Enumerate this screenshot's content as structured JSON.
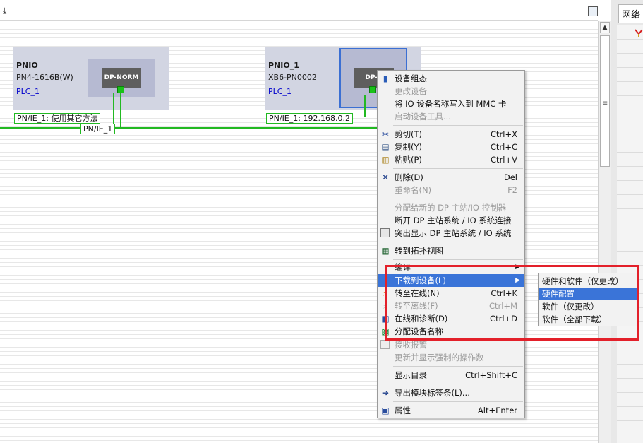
{
  "toolbar": {
    "download_icon": "download-icon",
    "panel_icon": "panel-toggle-icon"
  },
  "right_panel": {
    "tab_label": "网络"
  },
  "devices": [
    {
      "name": "PNIO",
      "model": "PN4-1616B(W)",
      "plc_link": "PLC_1",
      "chip_label": "DP-NORM",
      "net_label": "PN/IE_1:  使用其它方法"
    },
    {
      "name": "PNIO_1",
      "model": "XB6-PN0002",
      "plc_link": "PLC_1",
      "chip_label": "DP-N",
      "net_label": "PN/IE_1:  192.168.0.2"
    }
  ],
  "network_label": "PN/IE_1",
  "context_menu": {
    "items": [
      {
        "label": "设备组态",
        "shortcut": "",
        "icon": "device-config-icon",
        "disabled": false
      },
      {
        "label": "更改设备",
        "shortcut": "",
        "icon": "",
        "disabled": true
      },
      {
        "label": "将 IO 设备名称写入到 MMC 卡",
        "shortcut": "",
        "icon": "",
        "disabled": false
      },
      {
        "label": "启动设备工具...",
        "shortcut": "",
        "icon": "",
        "disabled": true
      },
      {
        "label": "剪切(T)",
        "shortcut": "Ctrl+X",
        "icon": "scissors-icon",
        "disabled": false
      },
      {
        "label": "复制(Y)",
        "shortcut": "Ctrl+C",
        "icon": "copy-icon",
        "disabled": false
      },
      {
        "label": "粘贴(P)",
        "shortcut": "Ctrl+V",
        "icon": "paste-icon",
        "disabled": false
      },
      {
        "label": "删除(D)",
        "shortcut": "Del",
        "icon": "delete-x-icon",
        "disabled": false
      },
      {
        "label": "重命名(N)",
        "shortcut": "F2",
        "icon": "",
        "disabled": true
      },
      {
        "label": "分配给新的 DP 主站/IO 控制器",
        "shortcut": "",
        "icon": "",
        "disabled": true
      },
      {
        "label": "断开 DP 主站系统 / IO 系统连接",
        "shortcut": "",
        "icon": "",
        "disabled": false
      },
      {
        "label": "突出显示 DP 主站系统 / IO 系统",
        "shortcut": "",
        "icon": "highlight-icon",
        "disabled": false
      },
      {
        "label": "转到拓扑视图",
        "shortcut": "",
        "icon": "topology-icon",
        "disabled": false
      },
      {
        "label": "编译",
        "shortcut": "",
        "icon": "",
        "disabled": false
      },
      {
        "label": "下载到设备(L)",
        "shortcut": "",
        "icon": "",
        "disabled": false
      },
      {
        "label": "转至在线(N)",
        "shortcut": "Ctrl+K",
        "icon": "go-online-icon",
        "disabled": false
      },
      {
        "label": "转至离线(F)",
        "shortcut": "Ctrl+M",
        "icon": "go-offline-icon",
        "disabled": true
      },
      {
        "label": "在线和诊断(D)",
        "shortcut": "Ctrl+D",
        "icon": "diagnostics-icon",
        "disabled": false
      },
      {
        "label": "分配设备名称",
        "shortcut": "",
        "icon": "assign-name-icon",
        "disabled": false
      },
      {
        "label": "接收报警",
        "shortcut": "",
        "icon": "checkbox-icon",
        "disabled": true
      },
      {
        "label": "更新并显示强制的操作数",
        "shortcut": "",
        "icon": "",
        "disabled": true
      },
      {
        "label": "显示目录",
        "shortcut": "Ctrl+Shift+C",
        "icon": "",
        "disabled": false
      },
      {
        "label": "导出模块标签条(L)...",
        "shortcut": "",
        "icon": "export-icon",
        "disabled": false
      },
      {
        "label": "属性",
        "shortcut": "Alt+Enter",
        "icon": "properties-icon",
        "disabled": false
      }
    ]
  },
  "submenu": {
    "items": [
      {
        "label": "硬件和软件（仅更改）"
      },
      {
        "label": "硬件配置"
      },
      {
        "label": "软件（仅更改）"
      },
      {
        "label": "软件（全部下载）"
      }
    ]
  },
  "colors": {
    "highlight": "#3a74d8",
    "network_green": "#22b922",
    "annotation_red": "#e3202a"
  }
}
